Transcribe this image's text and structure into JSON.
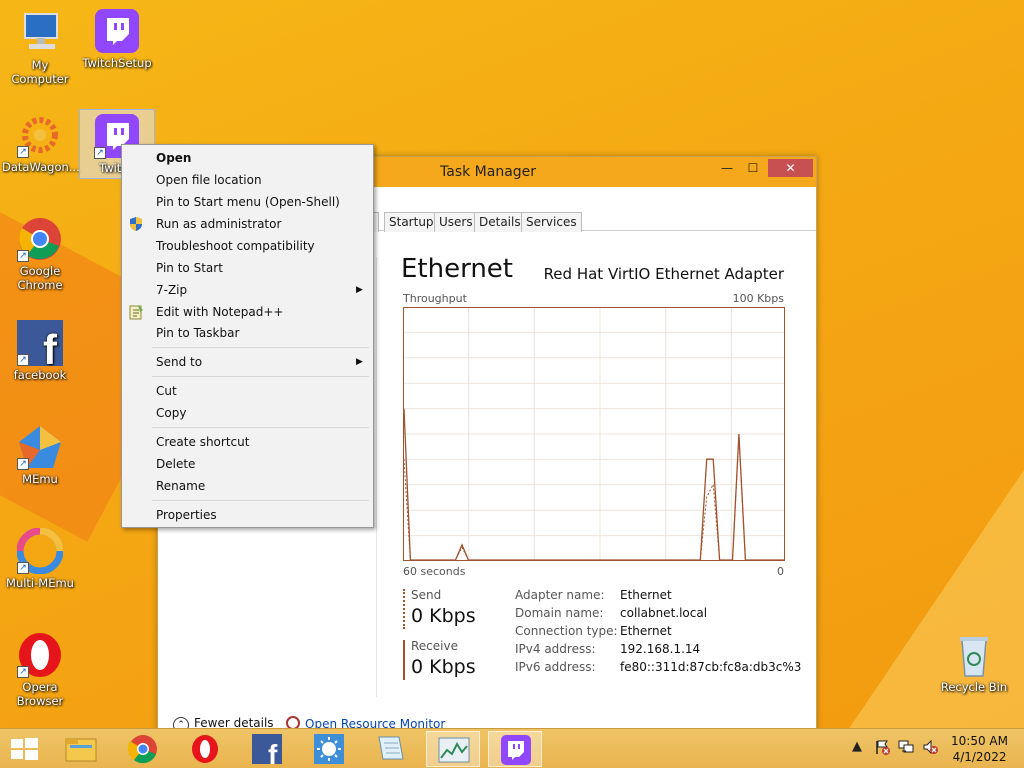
{
  "desktop": {
    "icons": [
      {
        "label": "My Computer",
        "icon": "computer-icon"
      },
      {
        "label": "TwitchSetup",
        "icon": "twitch-icon"
      },
      {
        "label": "DataWagon...",
        "icon": "datawagon-icon"
      },
      {
        "label": "Twitch",
        "icon": "twitch-icon"
      },
      {
        "label": "Google Chrome",
        "icon": "chrome-icon"
      },
      {
        "label": "facebook",
        "icon": "facebook-icon"
      },
      {
        "label": "MEmu",
        "icon": "memu-icon"
      },
      {
        "label": "Multi-MEmu",
        "icon": "multi-memu-icon"
      },
      {
        "label": "Opera Browser",
        "icon": "opera-icon"
      },
      {
        "label": "Recycle Bin",
        "icon": "recycle-bin-icon"
      }
    ]
  },
  "task_manager": {
    "title": "Task Manager",
    "tabs": [
      "y",
      "Startup",
      "Users",
      "Details",
      "Services"
    ],
    "panel_title": "Ethernet",
    "adapter": "Red Hat VirtIO Ethernet Adapter",
    "throughput_label": "Throughput",
    "max_label": "100 Kbps",
    "time_label": "60 seconds",
    "zero_label": "0",
    "send_label": "Send",
    "send_value": "0 Kbps",
    "receive_label": "Receive",
    "receive_value": "0 Kbps",
    "info": [
      {
        "key": "Adapter name:",
        "value": "Ethernet"
      },
      {
        "key": "Domain name:",
        "value": "collabnet.local"
      },
      {
        "key": "Connection type:",
        "value": "Ethernet"
      },
      {
        "key": "IPv4 address:",
        "value": "192.168.1.14"
      },
      {
        "key": "IPv6 address:",
        "value": "fe80::311d:87cb:fc8a:db3c%3"
      }
    ],
    "fewer_details": "Fewer details",
    "open_resource_monitor": "Open Resource Monitor",
    "graph_send": [
      60,
      0,
      0,
      0,
      0,
      0,
      0,
      0,
      0,
      6,
      0,
      0,
      0,
      0,
      0,
      0,
      0,
      0,
      0,
      0,
      0,
      0,
      0,
      0,
      0,
      0,
      0,
      0,
      0,
      0,
      0,
      0,
      0,
      0,
      0,
      0,
      0,
      0,
      0,
      0,
      0,
      0,
      0,
      0,
      0,
      0,
      0,
      40,
      40,
      0,
      0,
      0,
      50,
      0,
      0,
      0,
      0,
      0,
      0,
      0
    ],
    "graph_receive": [
      40,
      0,
      0,
      0,
      0,
      0,
      0,
      0,
      0,
      5,
      0,
      0,
      0,
      0,
      0,
      0,
      0,
      0,
      0,
      0,
      0,
      0,
      0,
      0,
      0,
      0,
      0,
      0,
      0,
      0,
      0,
      0,
      0,
      0,
      0,
      0,
      0,
      0,
      0,
      0,
      0,
      0,
      0,
      0,
      0,
      0,
      0,
      25,
      30,
      0,
      0,
      0,
      49,
      0,
      0,
      0,
      0,
      0,
      0,
      0
    ]
  },
  "context_menu": {
    "items": {
      "open": "Open",
      "open_file_location": "Open file location",
      "pin_start_menu": "Pin to Start menu (Open-Shell)",
      "run_as_admin": "Run as administrator",
      "troubleshoot": "Troubleshoot compatibility",
      "pin_to_start": "Pin to Start",
      "zip": "7-Zip",
      "edit_notepad": "Edit with Notepad++",
      "pin_taskbar": "Pin to Taskbar",
      "send_to": "Send to",
      "cut": "Cut",
      "copy": "Copy",
      "create_shortcut": "Create shortcut",
      "delete": "Delete",
      "rename": "Rename",
      "properties": "Properties"
    }
  },
  "taskbar": {
    "time": "10:50 AM",
    "date": "4/1/2022"
  },
  "colors": {
    "accent": "#f5a81b",
    "graph_line": "#a0522d"
  }
}
